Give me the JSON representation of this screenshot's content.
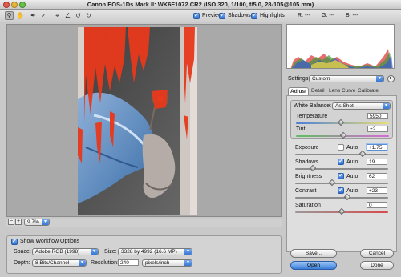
{
  "window": {
    "title": "Canon EOS-1Ds Mark II:  WK6F1072.CR2  (ISO 320, 1/100, f/5.0, 28-105@105 mm)"
  },
  "toolbar": {
    "tools": [
      "zoom-tool",
      "hand-tool",
      "white-balance-tool",
      "color-sampler-tool",
      "crop-tool",
      "straighten-tool",
      "rotate-left-tool",
      "rotate-right-tool"
    ],
    "preview_label": "Preview",
    "shadows_label": "Shadows",
    "highlights_label": "Highlights",
    "r_label": "R: ---",
    "g_label": "G: ---",
    "b_label": "B: ---"
  },
  "settings": {
    "label": "Settings:",
    "value": "Custom"
  },
  "tabs": [
    {
      "label": "Adjust",
      "active": true
    },
    {
      "label": "Detail"
    },
    {
      "label": "Lens"
    },
    {
      "label": "Curve"
    },
    {
      "label": "Calibrate"
    }
  ],
  "white_balance": {
    "label": "White Balance:",
    "value": "As Shot",
    "temperature_label": "Temperature",
    "temperature_value": "5950",
    "tint_label": "Tint",
    "tint_value": "+2"
  },
  "adjustments": [
    {
      "label": "Exposure",
      "auto_label": "Auto",
      "auto": false,
      "value": "+1.75"
    },
    {
      "label": "Shadows",
      "auto_label": "Auto",
      "auto": true,
      "value": "19"
    },
    {
      "label": "Brightness",
      "auto_label": "Auto",
      "auto": true,
      "value": "62"
    },
    {
      "label": "Contrast",
      "auto_label": "Auto",
      "auto": true,
      "value": "+23"
    },
    {
      "label": "Saturation",
      "value": "0"
    }
  ],
  "zoom": {
    "value": "9.7%",
    "minus": "−",
    "plus": "+"
  },
  "workflow": {
    "toggle_label": "Show Workflow Options",
    "space_label": "Space:",
    "space_value": "Adobe RGB (1998)",
    "size_label": "Size:",
    "size_value": "3328 by 4992  (16.6 MP)",
    "depth_label": "Depth:",
    "depth_value": "8 Bits/Channel",
    "resolution_label": "Resolution:",
    "resolution_value": "240",
    "resolution_unit": "pixels/inch"
  },
  "buttons": {
    "save": "Save...",
    "open": "Open",
    "cancel": "Cancel",
    "done": "Done"
  },
  "colors": {
    "highlight_clip": "#e8391c",
    "accent": "#3a7ed8"
  }
}
